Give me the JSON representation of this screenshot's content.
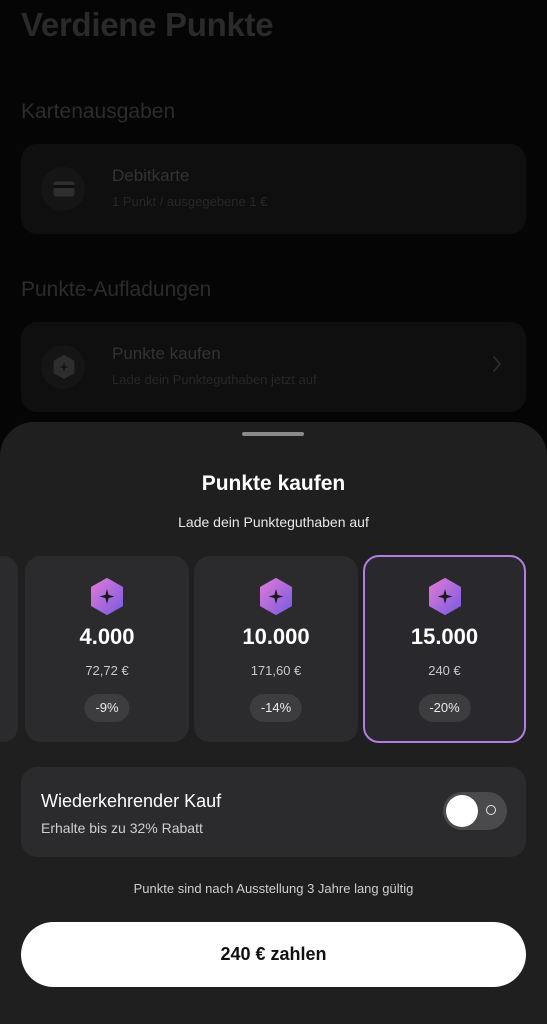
{
  "background": {
    "title": "Verdiene Punkte",
    "sections": [
      {
        "heading": "Kartenausgaben",
        "card": {
          "icon": "credit-card-icon",
          "title": "Debitkarte",
          "subtitle": "1 Punkt / ausgegebene 1 €"
        }
      },
      {
        "heading": "Punkte-Aufladungen",
        "card": {
          "icon": "points-hexagon-icon",
          "title": "Punkte kaufen",
          "subtitle": "Lade dein Punkteguthaben jetzt auf",
          "trailing_icon": "chevron-right-icon"
        }
      }
    ]
  },
  "sheet": {
    "title": "Punkte kaufen",
    "subtitle": "Lade dein Punkteguthaben auf",
    "packages": [
      {
        "amount": "4.000",
        "price": "72,72 €",
        "discount": "-9%",
        "selected": false
      },
      {
        "amount": "10.000",
        "price": "171,60 €",
        "discount": "-14%",
        "selected": false
      },
      {
        "amount": "15.000",
        "price": "240 €",
        "discount": "-20%",
        "selected": true
      }
    ],
    "recurring": {
      "title": "Wiederkehrender Kauf",
      "subtitle": "Erhalte bis zu 32% Rabatt",
      "toggle_on": false
    },
    "validity_note": "Punkte sind nach Ausstellung 3 Jahre lang gültig",
    "pay_button": "240 € zahlen"
  },
  "colors": {
    "sheet_bg": "#1f1f20",
    "card_bg": "#2b2b2d",
    "selected_border": "#b27ee3",
    "icon_gradient_start": "#e07ad7",
    "icon_gradient_end": "#7a5be0",
    "button_bg": "#ffffff"
  }
}
